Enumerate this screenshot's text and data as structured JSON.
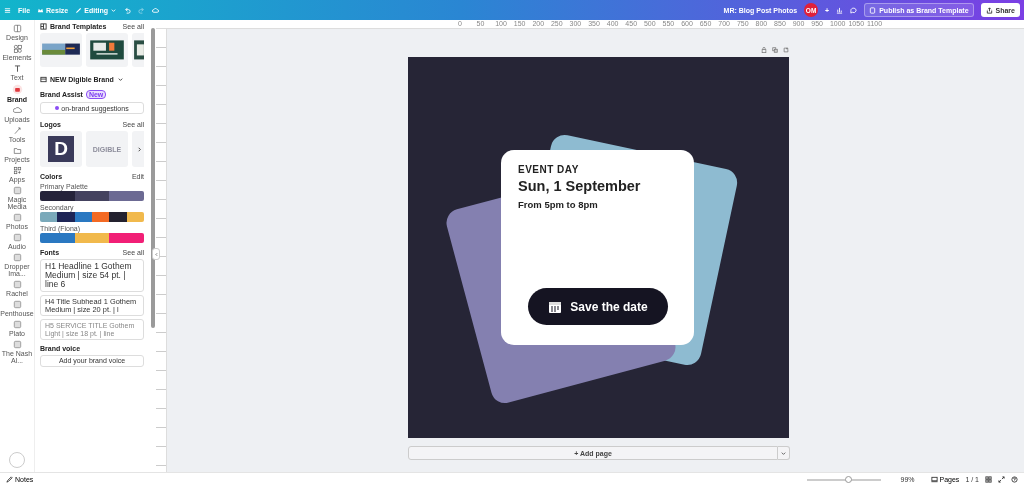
{
  "topbar": {
    "menu": [
      "File",
      "Resize",
      "Editing"
    ],
    "doc_title": "MR: Blog Post Photos",
    "avatar": "OM",
    "add": "+",
    "publish": "Publish as Brand Template",
    "share": "Share"
  },
  "rail": [
    {
      "label": "Design",
      "selected": false
    },
    {
      "label": "Elements",
      "selected": false
    },
    {
      "label": "Text",
      "selected": false
    },
    {
      "label": "Brand",
      "selected": true
    },
    {
      "label": "Uploads",
      "selected": false
    },
    {
      "label": "Tools",
      "selected": false
    },
    {
      "label": "Projects",
      "selected": false
    },
    {
      "label": "Apps",
      "selected": false
    },
    {
      "label": "Magic Media",
      "selected": false
    },
    {
      "label": "Photos",
      "selected": false
    },
    {
      "label": "Audio",
      "selected": false
    },
    {
      "label": "Dropper Ima...",
      "selected": false
    },
    {
      "label": "Rachel",
      "selected": false
    },
    {
      "label": "Penthouse",
      "selected": false
    },
    {
      "label": "Plato",
      "selected": false
    },
    {
      "label": "The Nash Al...",
      "selected": false
    }
  ],
  "panel": {
    "templates": {
      "title": "Brand Templates",
      "see_all": "See all"
    },
    "brand_kit": "NEW Digible Brand",
    "assist": {
      "title": "Brand Assist",
      "badge": "New",
      "button": "on-brand suggestions"
    },
    "logos": {
      "title": "Logos",
      "see_all": "See all",
      "mark": "D",
      "wordmark": "DIGIBLE"
    },
    "colors": {
      "title": "Colors",
      "edit": "Edit",
      "palettes": [
        {
          "name": "Primary Palette",
          "swatches": [
            {
              "color": "#25233a"
            },
            {
              "color": "#44425f"
            },
            {
              "color": "#6c6a93"
            }
          ]
        },
        {
          "name": "Secondary",
          "swatches": [
            {
              "color": "#7aa9ba"
            },
            {
              "color": "#1e2556"
            },
            {
              "color": "#2a78c1"
            },
            {
              "color": "#f36a24"
            },
            {
              "color": "#24222f"
            },
            {
              "color": "#f1b94c"
            }
          ]
        },
        {
          "name": "Third (Fiona)",
          "swatches": [
            {
              "color": "#2a78c1"
            },
            {
              "color": "#f1b94c"
            },
            {
              "color": "#f11f76"
            }
          ]
        }
      ]
    },
    "fonts": {
      "title": "Fonts",
      "see_all": "See all",
      "items": [
        {
          "text": "H1 Headline 1 Gothem Medium | size 54 pt. | line 6",
          "kind": "large"
        },
        {
          "text": "H4 Title Subhead 1 Gothem Medium | size 20 pt. | l",
          "kind": "medium"
        },
        {
          "text": "H5 SERVICE TITLE Gothem Light | size 18 pt. | line",
          "kind": "light"
        }
      ]
    },
    "voice": {
      "title": "Brand voice",
      "button": "Add your brand voice"
    }
  },
  "ruler": [
    "0",
    "50",
    "100",
    "150",
    "200",
    "250",
    "300",
    "350",
    "400",
    "450",
    "500",
    "550",
    "600",
    "650",
    "700",
    "750",
    "800",
    "850",
    "900",
    "950",
    "1000",
    "1050",
    "1100"
  ],
  "design": {
    "eyebrow": "EVENT DAY",
    "date": "Sun, 1 September",
    "time": "From 5pm to 8pm",
    "cta": "Save the date"
  },
  "add_page": "+ Add page",
  "status": {
    "notes": "Notes",
    "zoom": {
      "level": 0.57
    },
    "zoom_text": "99%",
    "pages": "Pages",
    "page_count": "1 / 1"
  }
}
